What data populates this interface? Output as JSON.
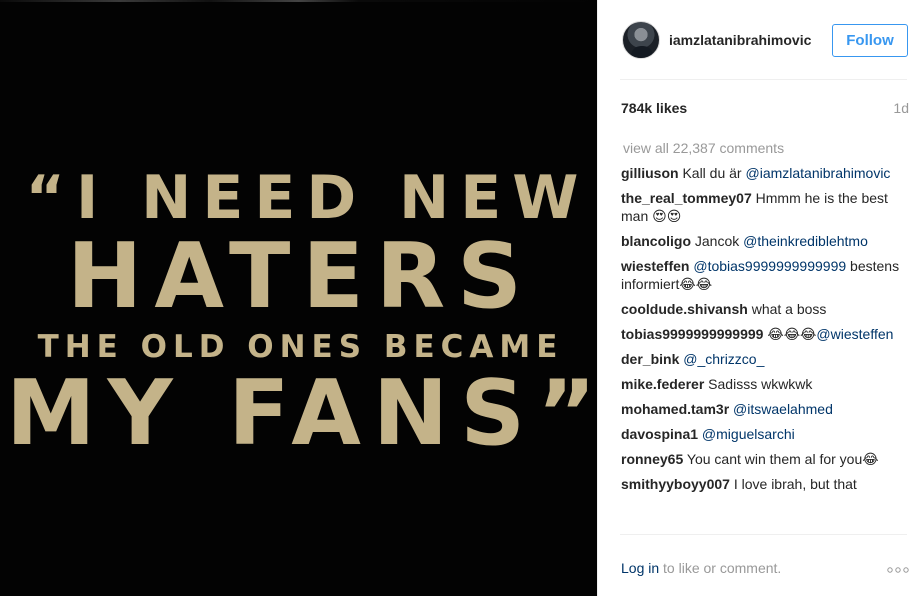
{
  "image": {
    "quote_lines": [
      "“I NEED NEW",
      "HATERS",
      "THE OLD ONES BECAME",
      "MY FANS”"
    ],
    "text_color": "#c4b389",
    "background_color": "#030303"
  },
  "header": {
    "username": "iamzlatanibrahimovic",
    "follow_label": "Follow"
  },
  "post": {
    "likes": "784k likes",
    "age": "1d",
    "view_all": "view all 22,387 comments"
  },
  "comments": [
    {
      "user": "gilliuson",
      "text": " Kall du är ",
      "mention": "@iamzlatanibrahimovic",
      "after": ""
    },
    {
      "user": "the_real_tommey07",
      "text": " Hmmm he is the best man 😍😍",
      "mention": "",
      "after": ""
    },
    {
      "user": "blancoligo",
      "text": " Jancok ",
      "mention": "@theinkrediblehtmo",
      "after": ""
    },
    {
      "user": "wiesteffen",
      "text": " ",
      "mention": "@tobias9999999999999",
      "after": " bestens informiert😂😂"
    },
    {
      "user": "cooldude.shivansh",
      "text": " what a boss",
      "mention": "",
      "after": ""
    },
    {
      "user": "tobias9999999999999",
      "text": " 😂😂😂",
      "mention": "@wiesteffen",
      "after": ""
    },
    {
      "user": "der_bink",
      "text": " ",
      "mention": "@_chrizzco_",
      "after": ""
    },
    {
      "user": "mike.federer",
      "text": " Sadisss wkwkwk",
      "mention": "",
      "after": ""
    },
    {
      "user": "mohamed.tam3r",
      "text": " ",
      "mention": "@itswaelahmed",
      "after": ""
    },
    {
      "user": "davospina1",
      "text": " ",
      "mention": "@miguelsarchi",
      "after": ""
    },
    {
      "user": "ronney65",
      "text": " You cant win them al for you😂",
      "mention": "",
      "after": ""
    },
    {
      "user": "smithyyboyy007",
      "text": " I love ibrah, but that",
      "mention": "",
      "after": ""
    }
  ],
  "footer": {
    "login_link": "Log in",
    "login_text": " to like or comment.",
    "more_icon": "more-options-icon"
  },
  "colors": {
    "link_blue": "#003569",
    "follow_blue": "#3897f0",
    "muted_gray": "#999999"
  }
}
